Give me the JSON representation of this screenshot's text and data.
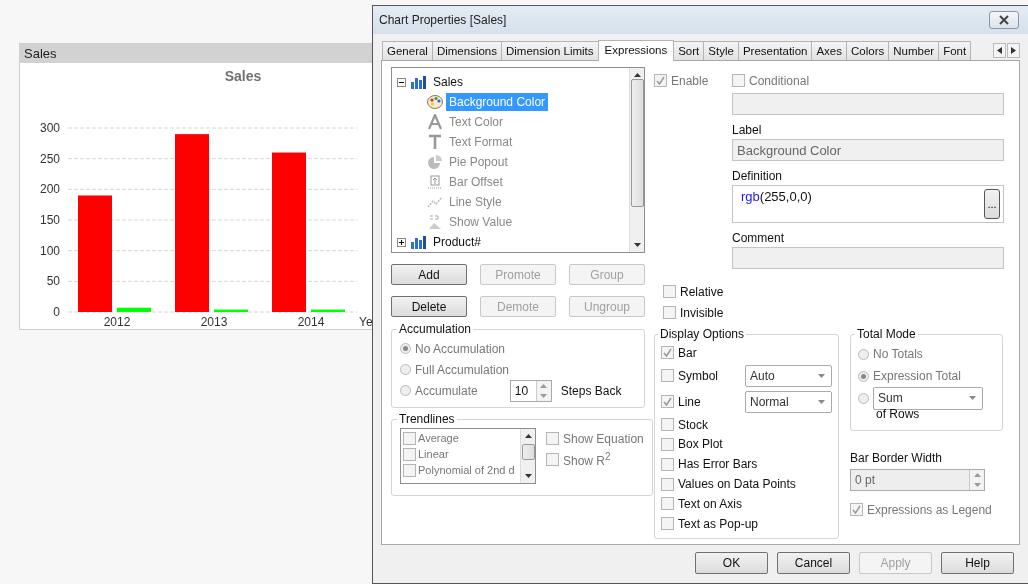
{
  "sheet_object": {
    "caption": "Sales",
    "chart_data": {
      "type": "bar",
      "title": "Sales",
      "xlabel": "Ye",
      "categories": [
        "2012",
        "2013",
        "2014"
      ],
      "series": [
        {
          "color": "#ff0000",
          "values": [
            190,
            290,
            260
          ]
        },
        {
          "color": "#00ff00",
          "values": [
            7,
            4,
            4
          ]
        }
      ],
      "grid": true,
      "ylim": [
        0,
        300
      ],
      "yticks": [
        0,
        50,
        100,
        150,
        200,
        250,
        300
      ]
    }
  },
  "dialog": {
    "title": "Chart Properties [Sales]",
    "tabs": [
      {
        "label": "General",
        "selected": false
      },
      {
        "label": "Dimensions",
        "selected": false
      },
      {
        "label": "Dimension Limits",
        "selected": false
      },
      {
        "label": "Expressions",
        "selected": true
      },
      {
        "label": "Sort",
        "selected": false
      },
      {
        "label": "Style",
        "selected": false
      },
      {
        "label": "Presentation",
        "selected": false
      },
      {
        "label": "Axes",
        "selected": false
      },
      {
        "label": "Colors",
        "selected": false
      },
      {
        "label": "Number",
        "selected": false
      },
      {
        "label": "Font",
        "selected": false
      }
    ],
    "tree": [
      {
        "label": "Sales",
        "kind": "bar-chart",
        "expanded": true,
        "selected": false,
        "children": [
          {
            "label": "Background Color",
            "kind": "palette",
            "selected": true,
            "disabled": false
          },
          {
            "label": "Text Color",
            "kind": "text-color",
            "selected": false,
            "disabled": true
          },
          {
            "label": "Text Format",
            "kind": "text-format",
            "selected": false,
            "disabled": true
          },
          {
            "label": "Pie Popout",
            "kind": "pie",
            "selected": false,
            "disabled": true
          },
          {
            "label": "Bar Offset",
            "kind": "bar-offset",
            "selected": false,
            "disabled": true
          },
          {
            "label": "Line Style",
            "kind": "line-style",
            "selected": false,
            "disabled": true
          },
          {
            "label": "Show Value",
            "kind": "show-value",
            "selected": false,
            "disabled": true
          }
        ]
      },
      {
        "label": "Product#",
        "kind": "bar-chart",
        "expanded": false,
        "selected": false
      }
    ],
    "tree_buttons": [
      {
        "label": "Add",
        "disabled": false
      },
      {
        "label": "Promote",
        "disabled": true
      },
      {
        "label": "Group",
        "disabled": true
      },
      {
        "label": "Delete",
        "disabled": false
      },
      {
        "label": "Demote",
        "disabled": true
      },
      {
        "label": "Ungroup",
        "disabled": true
      }
    ],
    "enable": {
      "label": "Enable",
      "checked": true,
      "disabled": true
    },
    "conditional": {
      "label": "Conditional",
      "checked": false,
      "disabled": true
    },
    "label_field": {
      "label": "Label",
      "value": "Background Color"
    },
    "definition": {
      "label": "Definition",
      "value": "rgb(255,0,0)",
      "button": "..."
    },
    "comment": {
      "label": "Comment"
    },
    "relative": {
      "label": "Relative",
      "checked": false
    },
    "invisible": {
      "label": "Invisible",
      "checked": false
    },
    "accumulation": {
      "title": "Accumulation",
      "options": [
        {
          "label": "No Accumulation",
          "selected": true
        },
        {
          "label": "Full Accumulation",
          "selected": false
        },
        {
          "label": "Accumulate",
          "selected": false
        }
      ],
      "steps": "10",
      "steps_label": "Steps Back"
    },
    "trendlines": {
      "title": "Trendlines",
      "items": [
        {
          "label": "Average",
          "checked": false
        },
        {
          "label": "Linear",
          "checked": false
        },
        {
          "label": "Polynomial of 2nd d",
          "checked": false
        }
      ],
      "show_equation": {
        "label": "Show Equation",
        "checked": false
      },
      "show_r2": {
        "label": "Show R$^{2}$",
        "checked": false
      }
    },
    "display_options": {
      "title": "Display Options",
      "items": [
        {
          "label": "Bar",
          "checked": true,
          "kind": "check"
        },
        {
          "label": "Symbol",
          "checked": false,
          "kind": "check-select",
          "value": "Auto"
        },
        {
          "label": "Line",
          "checked": true,
          "kind": "check-select",
          "value": "Normal"
        },
        {
          "label": "Stock",
          "checked": false,
          "kind": "check"
        },
        {
          "label": "Box Plot",
          "checked": false,
          "kind": "check"
        },
        {
          "label": "Has Error Bars",
          "checked": false,
          "kind": "check"
        },
        {
          "label": "Values on Data Points",
          "checked": false,
          "kind": "check"
        },
        {
          "label": "Text on Axis",
          "checked": false,
          "kind": "check"
        },
        {
          "label": "Text as Pop-up",
          "checked": false,
          "kind": "check"
        }
      ]
    },
    "total_mode": {
      "title": "Total Mode",
      "options": [
        {
          "label": "No Totals",
          "selected": false,
          "kind": "radio"
        },
        {
          "label": "Expression Total",
          "selected": true,
          "kind": "radio"
        },
        {
          "value": "Sum",
          "selected": false,
          "kind": "radio-select"
        }
      ],
      "suffix": "of Rows"
    },
    "bar_border_width": {
      "label": "Bar Border Width",
      "value": "0 pt"
    },
    "expressions_as_legend": {
      "label": "Expressions as Legend",
      "checked": true
    },
    "buttons": [
      {
        "label": "OK",
        "disabled": false
      },
      {
        "label": "Cancel",
        "disabled": false
      },
      {
        "label": "Apply",
        "disabled": true
      },
      {
        "label": "Help",
        "disabled": false
      }
    ]
  }
}
